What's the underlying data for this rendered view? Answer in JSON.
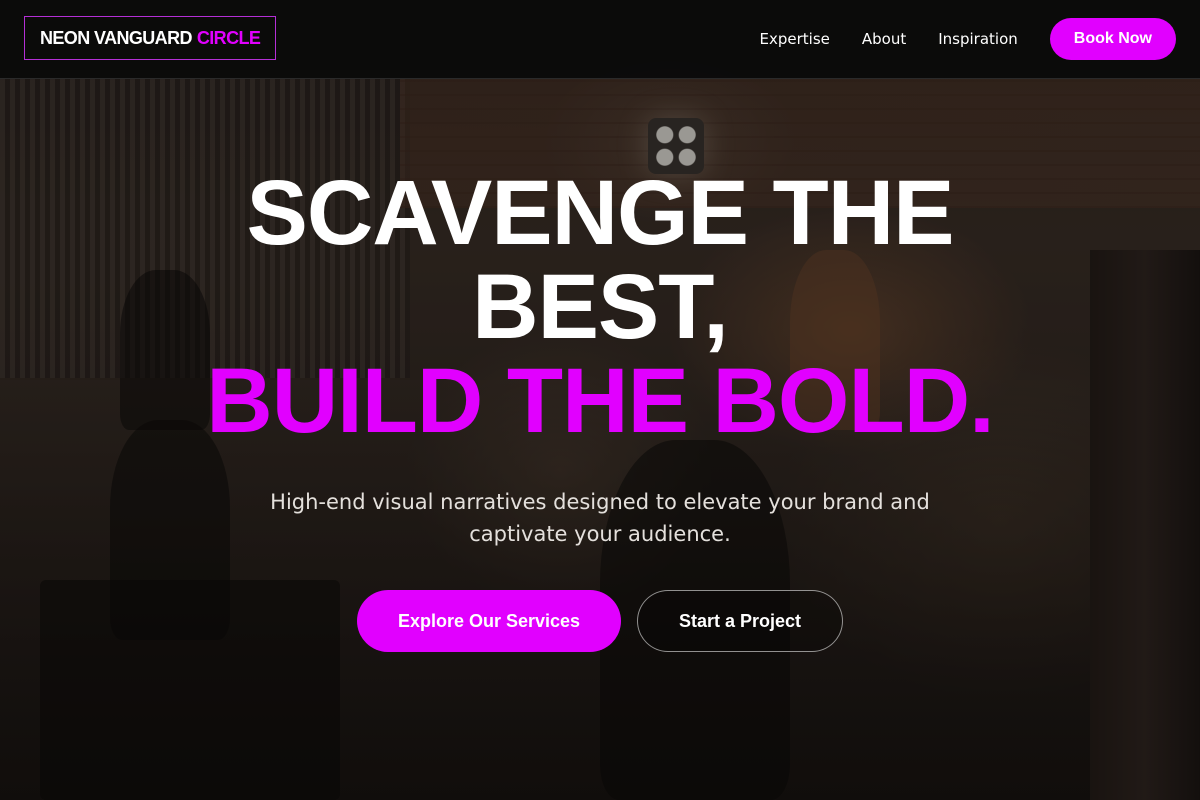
{
  "colors": {
    "accent": "#e100ff",
    "nav_background": "#0a0a0a",
    "text": "#ffffff"
  },
  "nav": {
    "logo_main": "NEON VANGUARD",
    "logo_accent": "CIRCLE",
    "links": [
      "Expertise",
      "About",
      "Inspiration"
    ],
    "cta_label": "Book Now"
  },
  "hero": {
    "headline_line1": "SCAVENGE THE",
    "headline_line2": "BEST,",
    "headline_line3": "BUILD THE BOLD.",
    "subtitle": "High-end visual narratives designed to elevate your brand and captivate your audience.",
    "primary_cta": "Explore Our Services",
    "secondary_cta": "Start a Project"
  }
}
